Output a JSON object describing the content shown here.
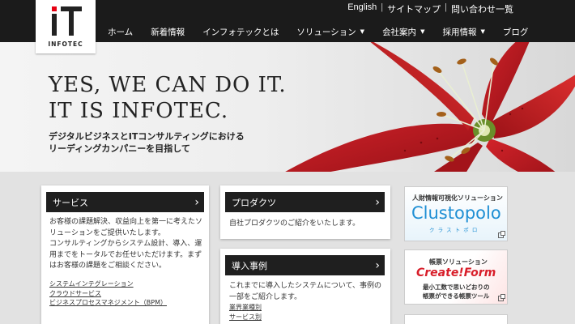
{
  "logo": {
    "mark": "IT",
    "text": "INFOTEC"
  },
  "utility_nav": {
    "english": "English",
    "sitemap": "サイトマップ",
    "contact": "問い合わせ一覧"
  },
  "global_nav": {
    "home": "ホーム",
    "news": "新着情報",
    "about": "インフォテックとは",
    "solutions": "ソリューション",
    "company": "会社案内",
    "recruit": "採用情報",
    "blog": "ブログ"
  },
  "hero": {
    "title_line1": "YES, WE CAN DO IT.",
    "title_line2": "IT IS INFOTEC.",
    "sub_line1": "デジタルビジネスとITコンサルティングにおける",
    "sub_line2": "リーディングカンパニーを目指して"
  },
  "services": {
    "title": "サービス",
    "body": [
      "お客様の課題解決、収益向上を第一に考えたソ",
      "リューションをご提供いたします。",
      "コンサルティングからシステム設計、導入、運",
      "用までをトータルでお任せいただけます。まず",
      "はお客様の課題をご相談ください。"
    ],
    "links": [
      "システムインテグレーション",
      "クラウドサービス",
      "ビジネスプロセスマネジメント（BPM）"
    ]
  },
  "products": {
    "title": "プロダクツ",
    "body": "自社プロダクツのご紹介をいたします。"
  },
  "cases": {
    "title": "導入事例",
    "body": [
      "これまでに導入したシステムについて、事例の",
      "一部をご紹介します。"
    ],
    "links": [
      "業界業種別",
      "サービス別"
    ]
  },
  "banners": {
    "clustopolo": {
      "tag": "人財情報可視化ソリューション",
      "name": "Clustopolo",
      "kana": "ク ラ ス ト ポ ロ"
    },
    "createform": {
      "tag": "帳票ソリューション",
      "name": "Create!Form",
      "line1": "最小工数で思いどおりの",
      "line2": "帳票ができる帳票ツール"
    }
  },
  "colors": {
    "header": "#1b1b1b",
    "accent_red": "#e60012",
    "clustopolo_blue": "#1f8fd4",
    "createform_red": "#d81e2a"
  }
}
